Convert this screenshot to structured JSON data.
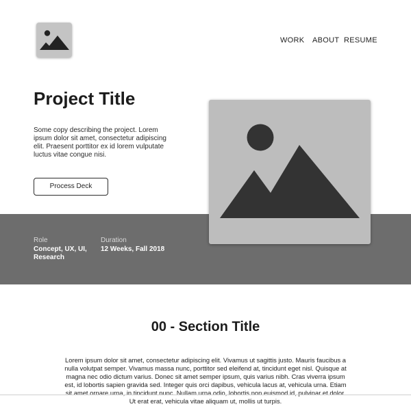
{
  "header": {
    "logo_icon": "image-placeholder-icon",
    "nav": {
      "work": "WORK",
      "about": "ABOUT",
      "resume": "RESUME"
    }
  },
  "hero": {
    "title": "Project Title",
    "copy": "Some copy describing the project. Lorem ipsum dolor sit amet, consectetur adipiscing elit. Praesent porttitor ex id lorem vulputate luctus vitae congue nisi.",
    "button_label": "Process Deck",
    "image_icon": "image-placeholder-icon"
  },
  "meta": {
    "role_label": "Role",
    "role_value": "Concept, UX, UI, Research",
    "duration_label": "Duration",
    "duration_value": "12 Weeks, Fall 2018"
  },
  "section": {
    "title": "00 - Section Title",
    "body": "Lorem ipsum dolor sit amet, consectetur adipiscing elit. Vivamus ut sagittis justo. Mauris faucibus a nulla volutpat semper. Vivamus massa nunc, porttitor sed eleifend at, tincidunt eget nisl. Quisque at magna nec odio dictum varius. Donec sit amet semper ipsum, quis varius nibh. Cras viverra ipsum est, id lobortis sapien gravida sed. Integer quis orci dapibus, vehicula lacus at, vehicula urna. Etiam sit amet ornare urna, in tincidunt nunc. Nullam urna odio, lobortis non euismod id, pulvinar et dolor. Ut erat erat, vehicula vitae aliquam ut, mollis ut turpis."
  },
  "colors": {
    "band": "#6d6d6d",
    "placeholder_bg": "#bdbdbd",
    "placeholder_shape": "#333333",
    "text": "#1c1c1c"
  }
}
